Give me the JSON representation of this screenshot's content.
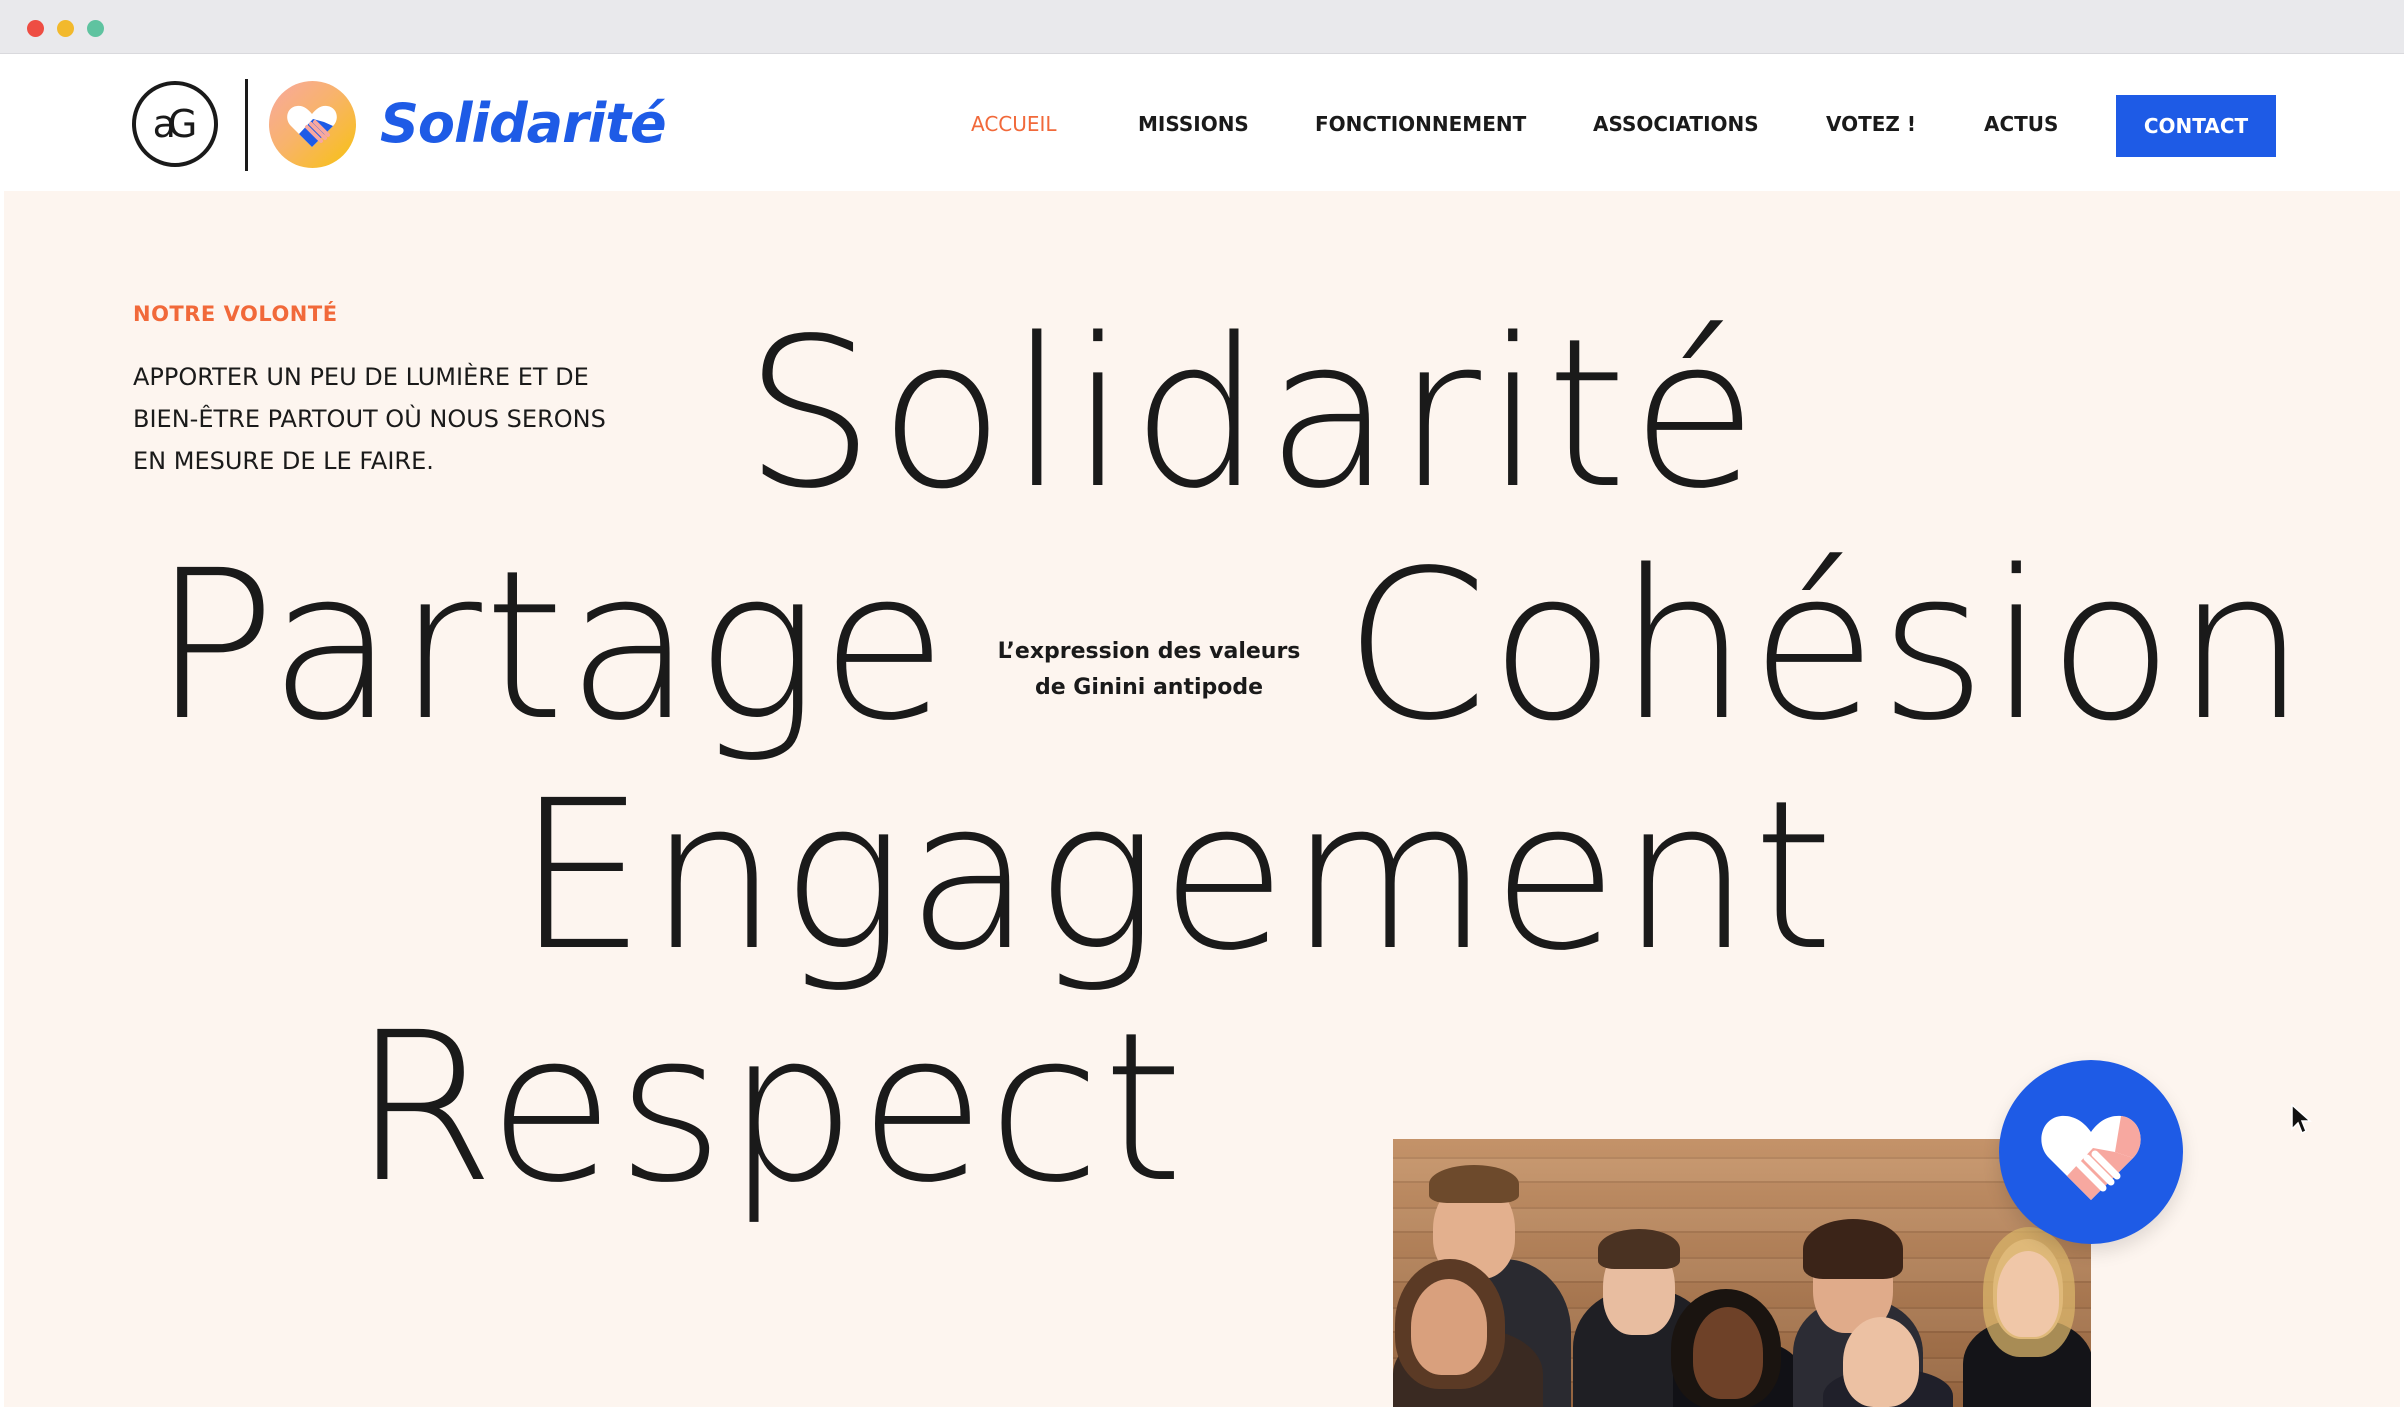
{
  "brand": {
    "ag_mark": "aG",
    "name": "Solidarité"
  },
  "nav": {
    "items": [
      {
        "label": "ACCUEIL",
        "active": true
      },
      {
        "label": "MISSIONS",
        "active": false
      },
      {
        "label": "FONCTIONNEMENT",
        "active": false
      },
      {
        "label": "ASSOCIATIONS",
        "active": false
      },
      {
        "label": "VOTEZ !",
        "active": false
      },
      {
        "label": "ACTUS",
        "active": false
      }
    ],
    "contact_label": "CONTACT"
  },
  "hero": {
    "eyebrow": "NOTRE VOLONTÉ",
    "intro_lines": [
      "APPORTER UN PEU DE LUMIÈRE ET DE",
      "BIEN-ÊTRE PARTOUT OÙ NOUS SERONS",
      "EN MESURE DE LE FAIRE."
    ],
    "values": [
      "Solidarité",
      "Partage",
      "Cohésion",
      "Engagement",
      "Respect"
    ],
    "tagline_lines": [
      "L’expression des valeurs",
      "de Ginini antipode"
    ]
  },
  "colors": {
    "accent_orange": "#f1693a",
    "brand_blue": "#1e5be6",
    "hero_background": "#fdf5ef",
    "text": "#1a1a1a"
  },
  "icons": [
    "handshake-heart-icon",
    "cursor-icon"
  ]
}
